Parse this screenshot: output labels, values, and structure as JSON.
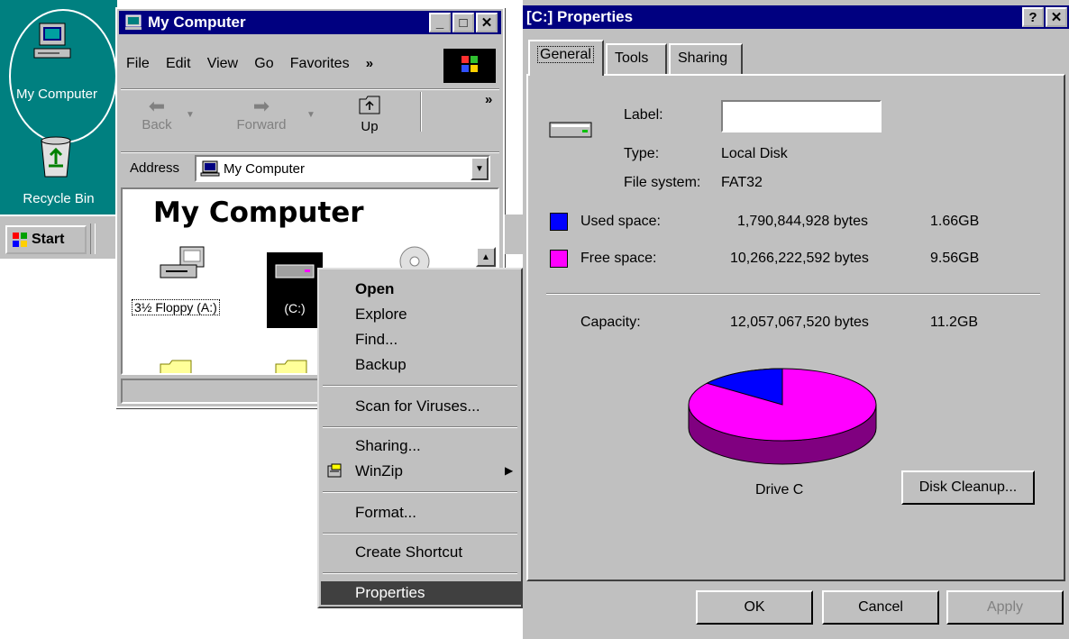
{
  "desktop": {
    "icons": [
      {
        "label": "My Computer"
      },
      {
        "label": "Recycle Bin"
      }
    ],
    "taskbar": {
      "start_label": "Start"
    }
  },
  "my_computer": {
    "title": "My Computer",
    "menu": [
      "File",
      "Edit",
      "View",
      "Go",
      "Favorites"
    ],
    "toolbar": {
      "back": "Back",
      "forward": "Forward",
      "up": "Up"
    },
    "address_label": "Address",
    "address_value": "My Computer",
    "heading": "My Computer",
    "files": [
      {
        "label": "3½ Floppy (A:)"
      },
      {
        "label": "(C:)"
      }
    ]
  },
  "context_menu": {
    "items": [
      {
        "label": "Open"
      },
      {
        "label": "Explore"
      },
      {
        "label": "Find..."
      },
      {
        "label": "Backup"
      },
      {
        "label": "Scan for Viruses..."
      },
      {
        "label": "Sharing..."
      },
      {
        "label": "WinZip"
      },
      {
        "label": "Format..."
      },
      {
        "label": "Create Shortcut"
      },
      {
        "label": "Properties"
      }
    ]
  },
  "properties": {
    "title": "[C:] Properties",
    "tabs": [
      "General",
      "Tools",
      "Sharing"
    ],
    "label_caption": "Label:",
    "label_value": "",
    "type_caption": "Type:",
    "type_value": "Local Disk",
    "fs_caption": "File system:",
    "fs_value": "FAT32",
    "used": {
      "caption": "Used space:",
      "bytes": "1,790,844,928 bytes",
      "size": "1.66GB",
      "color": "#0000ff"
    },
    "free": {
      "caption": "Free space:",
      "bytes": "10,266,222,592 bytes",
      "size": "9.56GB",
      "color": "#ff00ff"
    },
    "capacity": {
      "caption": "Capacity:",
      "bytes": "12,057,067,520 bytes",
      "size": "11.2GB"
    },
    "drive_label": "Drive C",
    "disk_cleanup": "Disk Cleanup...",
    "buttons": {
      "ok": "OK",
      "cancel": "Cancel",
      "apply": "Apply"
    }
  },
  "chart_data": {
    "type": "pie",
    "categories": [
      "Used space",
      "Free space"
    ],
    "values": [
      1790844928,
      10266222592
    ],
    "colors": [
      "#0000ff",
      "#ff00ff"
    ]
  }
}
